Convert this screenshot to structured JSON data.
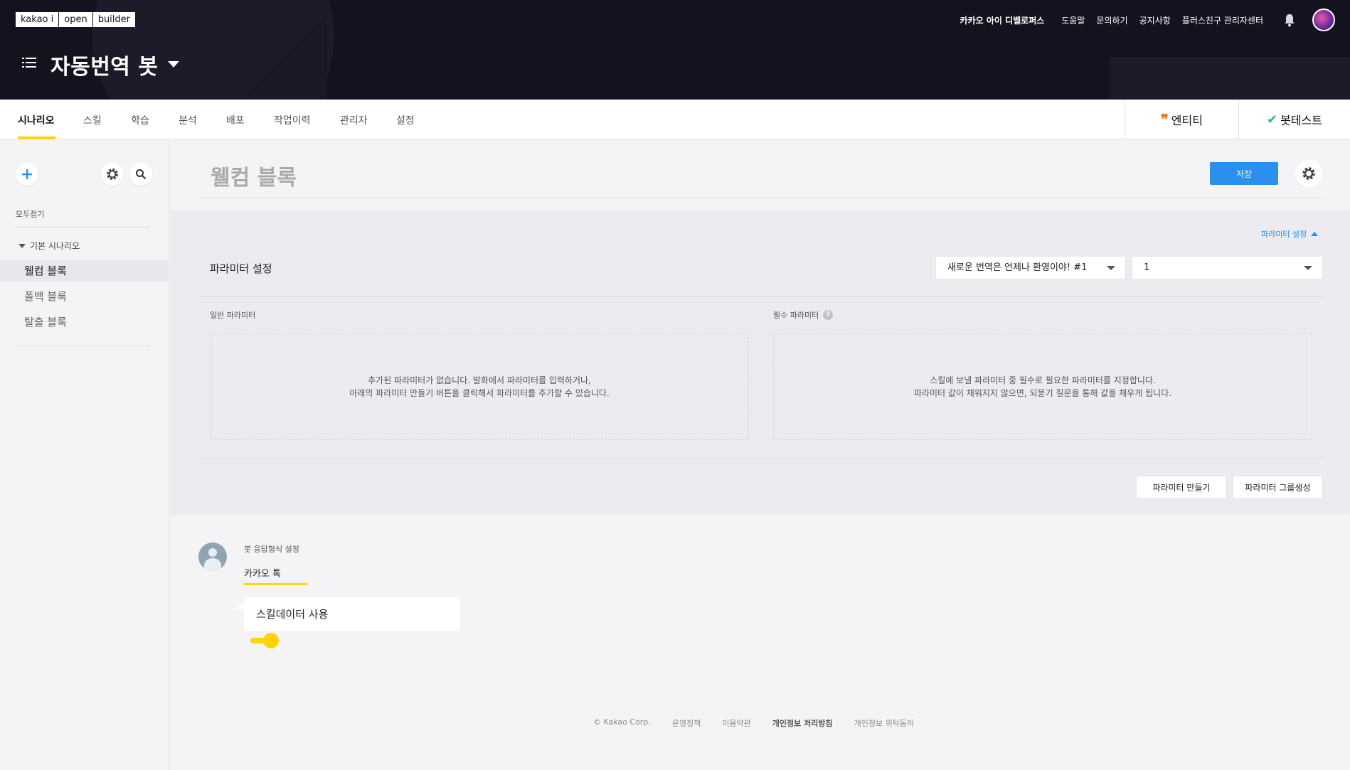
{
  "header": {
    "logo": [
      "kakao i",
      "open",
      "builder"
    ],
    "nav": {
      "developers": "카카오 아이 디벨로퍼스",
      "help": "도움말",
      "inquiry": "문의하기",
      "notice": "공지사항",
      "plus_friend_admin": "플러스친구 관리자센터"
    },
    "bot_title": "자동번역 봇"
  },
  "tabs": {
    "items": [
      "시나리오",
      "스킬",
      "학습",
      "분석",
      "배포",
      "작업이력",
      "관리자",
      "설정"
    ],
    "active": "시나리오",
    "entity": "엔티티",
    "bot_test": "봇테스트"
  },
  "sidebar": {
    "collapse_all": "모두접기",
    "group": "기본 시나리오",
    "blocks": [
      "웰컴 블록",
      "폴백 블록",
      "탈출 블록"
    ],
    "active_block": "웰컴 블록"
  },
  "main": {
    "block_title": "웰컴 블록",
    "save": "저장",
    "param_toggle": "파라미터 설정",
    "param_heading": "파라미터 설정",
    "select_utterance": "새로운 번역은 언제나 환영이야! #1",
    "select_count": "1",
    "general_params": {
      "label": "일반 파라미터",
      "empty_line1": "추가된 파라미터가 없습니다. 발화에서 파라미터를 입력하거나,",
      "empty_line2": "아래의 파라미터 만들기 버튼을 클릭해서 파라미터를 추가할 수 있습니다."
    },
    "required_params": {
      "label": "필수 파라미터",
      "help": "?",
      "desc_line1": "스킬에 보낼 파라미터 중 필수로 필요한 파라미터를 지정합니다.",
      "desc_line2": "파라미터 값이 채워지지 않으면, 되묻기 질문을 통해 값을 채우게 됩니다."
    },
    "create_param": "파라미터 만들기",
    "create_param_group": "파라미터 그룹생성"
  },
  "response": {
    "label": "봇 응답형식 설정",
    "tab": "카카오 톡",
    "bubble": "스킬데이터 사용",
    "toggle_on": true
  },
  "footer": {
    "copyright": "© Kakao Corp.",
    "policy": "운영정책",
    "terms": "이용약관",
    "privacy": "개인정보 처리방침",
    "privacy_consign": "개인정보 위탁동의"
  },
  "colors": {
    "header_bg": "#13131f",
    "accent_yellow": "#ffd400",
    "save_blue": "#2b8fee",
    "entity_orange": "#f07a12",
    "check_green": "#3bb56a"
  }
}
